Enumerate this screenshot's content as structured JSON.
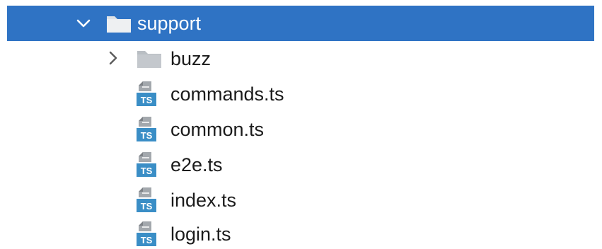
{
  "tree": {
    "root": {
      "label": "support",
      "expanded": true,
      "selected": true,
      "icon": "folder-icon"
    },
    "children": [
      {
        "type": "folder",
        "label": "buzz",
        "expanded": false,
        "icon": "folder-icon"
      },
      {
        "type": "file",
        "label": "commands.ts",
        "icon": "typescript-file-icon",
        "badge": "TS"
      },
      {
        "type": "file",
        "label": "common.ts",
        "icon": "typescript-file-icon",
        "badge": "TS"
      },
      {
        "type": "file",
        "label": "e2e.ts",
        "icon": "typescript-file-icon",
        "badge": "TS"
      },
      {
        "type": "file",
        "label": "index.ts",
        "icon": "typescript-file-icon",
        "badge": "TS"
      },
      {
        "type": "file",
        "label": "login.ts",
        "icon": "typescript-file-icon",
        "badge": "TS"
      }
    ]
  },
  "colors": {
    "selection": "#2f73c4",
    "folder": "#b9bec3",
    "ts_badge": "#3a8ec6",
    "text": "#1b1b1b"
  }
}
